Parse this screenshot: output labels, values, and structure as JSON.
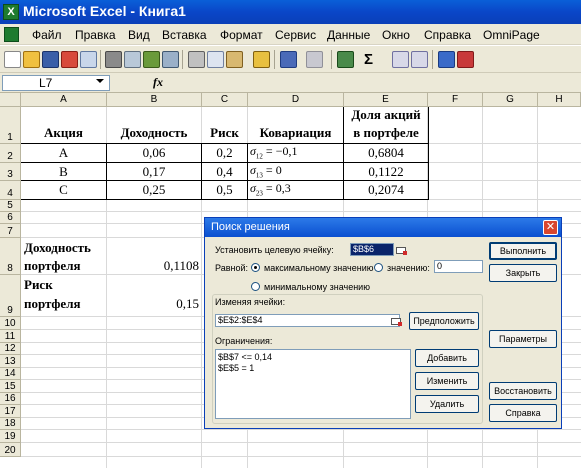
{
  "window": {
    "title": "Microsoft Excel - Книга1"
  },
  "menu": [
    "Файл",
    "Правка",
    "Вид",
    "Вставка",
    "Формат",
    "Сервис",
    "Данные",
    "Окно",
    "Справка",
    "OmniPage"
  ],
  "toolbar": {
    "icons": [
      "new-icon",
      "open-icon",
      "save-icon",
      "permission-icon",
      "email-icon",
      "print-icon",
      "print-preview-icon",
      "spelling-icon",
      "research-icon",
      "cut-icon",
      "copy-icon",
      "paste-icon",
      "format-painter-icon",
      "undo-icon",
      "redo-icon",
      "hyperlink-icon",
      "autosum-icon",
      "sort-ascending-icon",
      "sort-descending-icon",
      "chart-wizard-icon",
      "drawing-icon"
    ],
    "sigma": "Σ"
  },
  "formula_bar": {
    "name_box": "L7",
    "fx": "fx",
    "formula": ""
  },
  "columns": [
    "A",
    "B",
    "C",
    "D",
    "E",
    "F",
    "G",
    "H"
  ],
  "rows": [
    "1",
    "2",
    "3",
    "4",
    "5",
    "6",
    "7",
    "8",
    "9",
    "10",
    "11",
    "12",
    "13",
    "14",
    "15",
    "16",
    "17",
    "18",
    "19",
    "20"
  ],
  "sheet": {
    "headers": {
      "a": "Акция",
      "b": "Доходность",
      "c": "Риск",
      "d": "Ковариация",
      "e1": "Доля акций",
      "e2": "в портфеле"
    },
    "data": [
      {
        "a": "A",
        "b": "0,06",
        "c": "0,2",
        "d_sym": "σ",
        "d_sub": "12",
        "d_val": " = −0,1",
        "e": "0,6804"
      },
      {
        "a": "B",
        "b": "0,17",
        "c": "0,4",
        "d_sym": "σ",
        "d_sub": "13",
        "d_val": " = 0",
        "e": "0,1122"
      },
      {
        "a": "C",
        "b": "0,25",
        "c": "0,5",
        "d_sym": "σ",
        "d_sub": "23",
        "d_val": " = 0,3",
        "e": "0,2074"
      }
    ],
    "return_label1": "Доходность",
    "return_label2": "портфеля",
    "return_value": "0,1108",
    "risk_label1": "Риск",
    "risk_label2": "портфеля",
    "risk_value": "0,15"
  },
  "solver": {
    "title": "Поиск решения",
    "target_label": "Установить целевую ячейку:",
    "target_value": "$B$6",
    "equal_label": "Равной:",
    "opt_max": "максимальному значению",
    "opt_value": "значению:",
    "value_field": "0",
    "opt_min": "минимальному значению",
    "changing_label": "Изменяя ячейки:",
    "changing_value": "$E$2:$E$4",
    "constraints_label": "Ограничения:",
    "constraints": [
      "$B$7 <= 0,14",
      "$E$5 = 1"
    ],
    "btn_solve": "Выполнить",
    "btn_close": "Закрыть",
    "btn_guess": "Предположить",
    "btn_options": "Параметры",
    "btn_add": "Добавить",
    "btn_change": "Изменить",
    "btn_delete": "Удалить",
    "btn_reset": "Восстановить",
    "btn_help": "Справка",
    "close_glyph": "✕"
  }
}
